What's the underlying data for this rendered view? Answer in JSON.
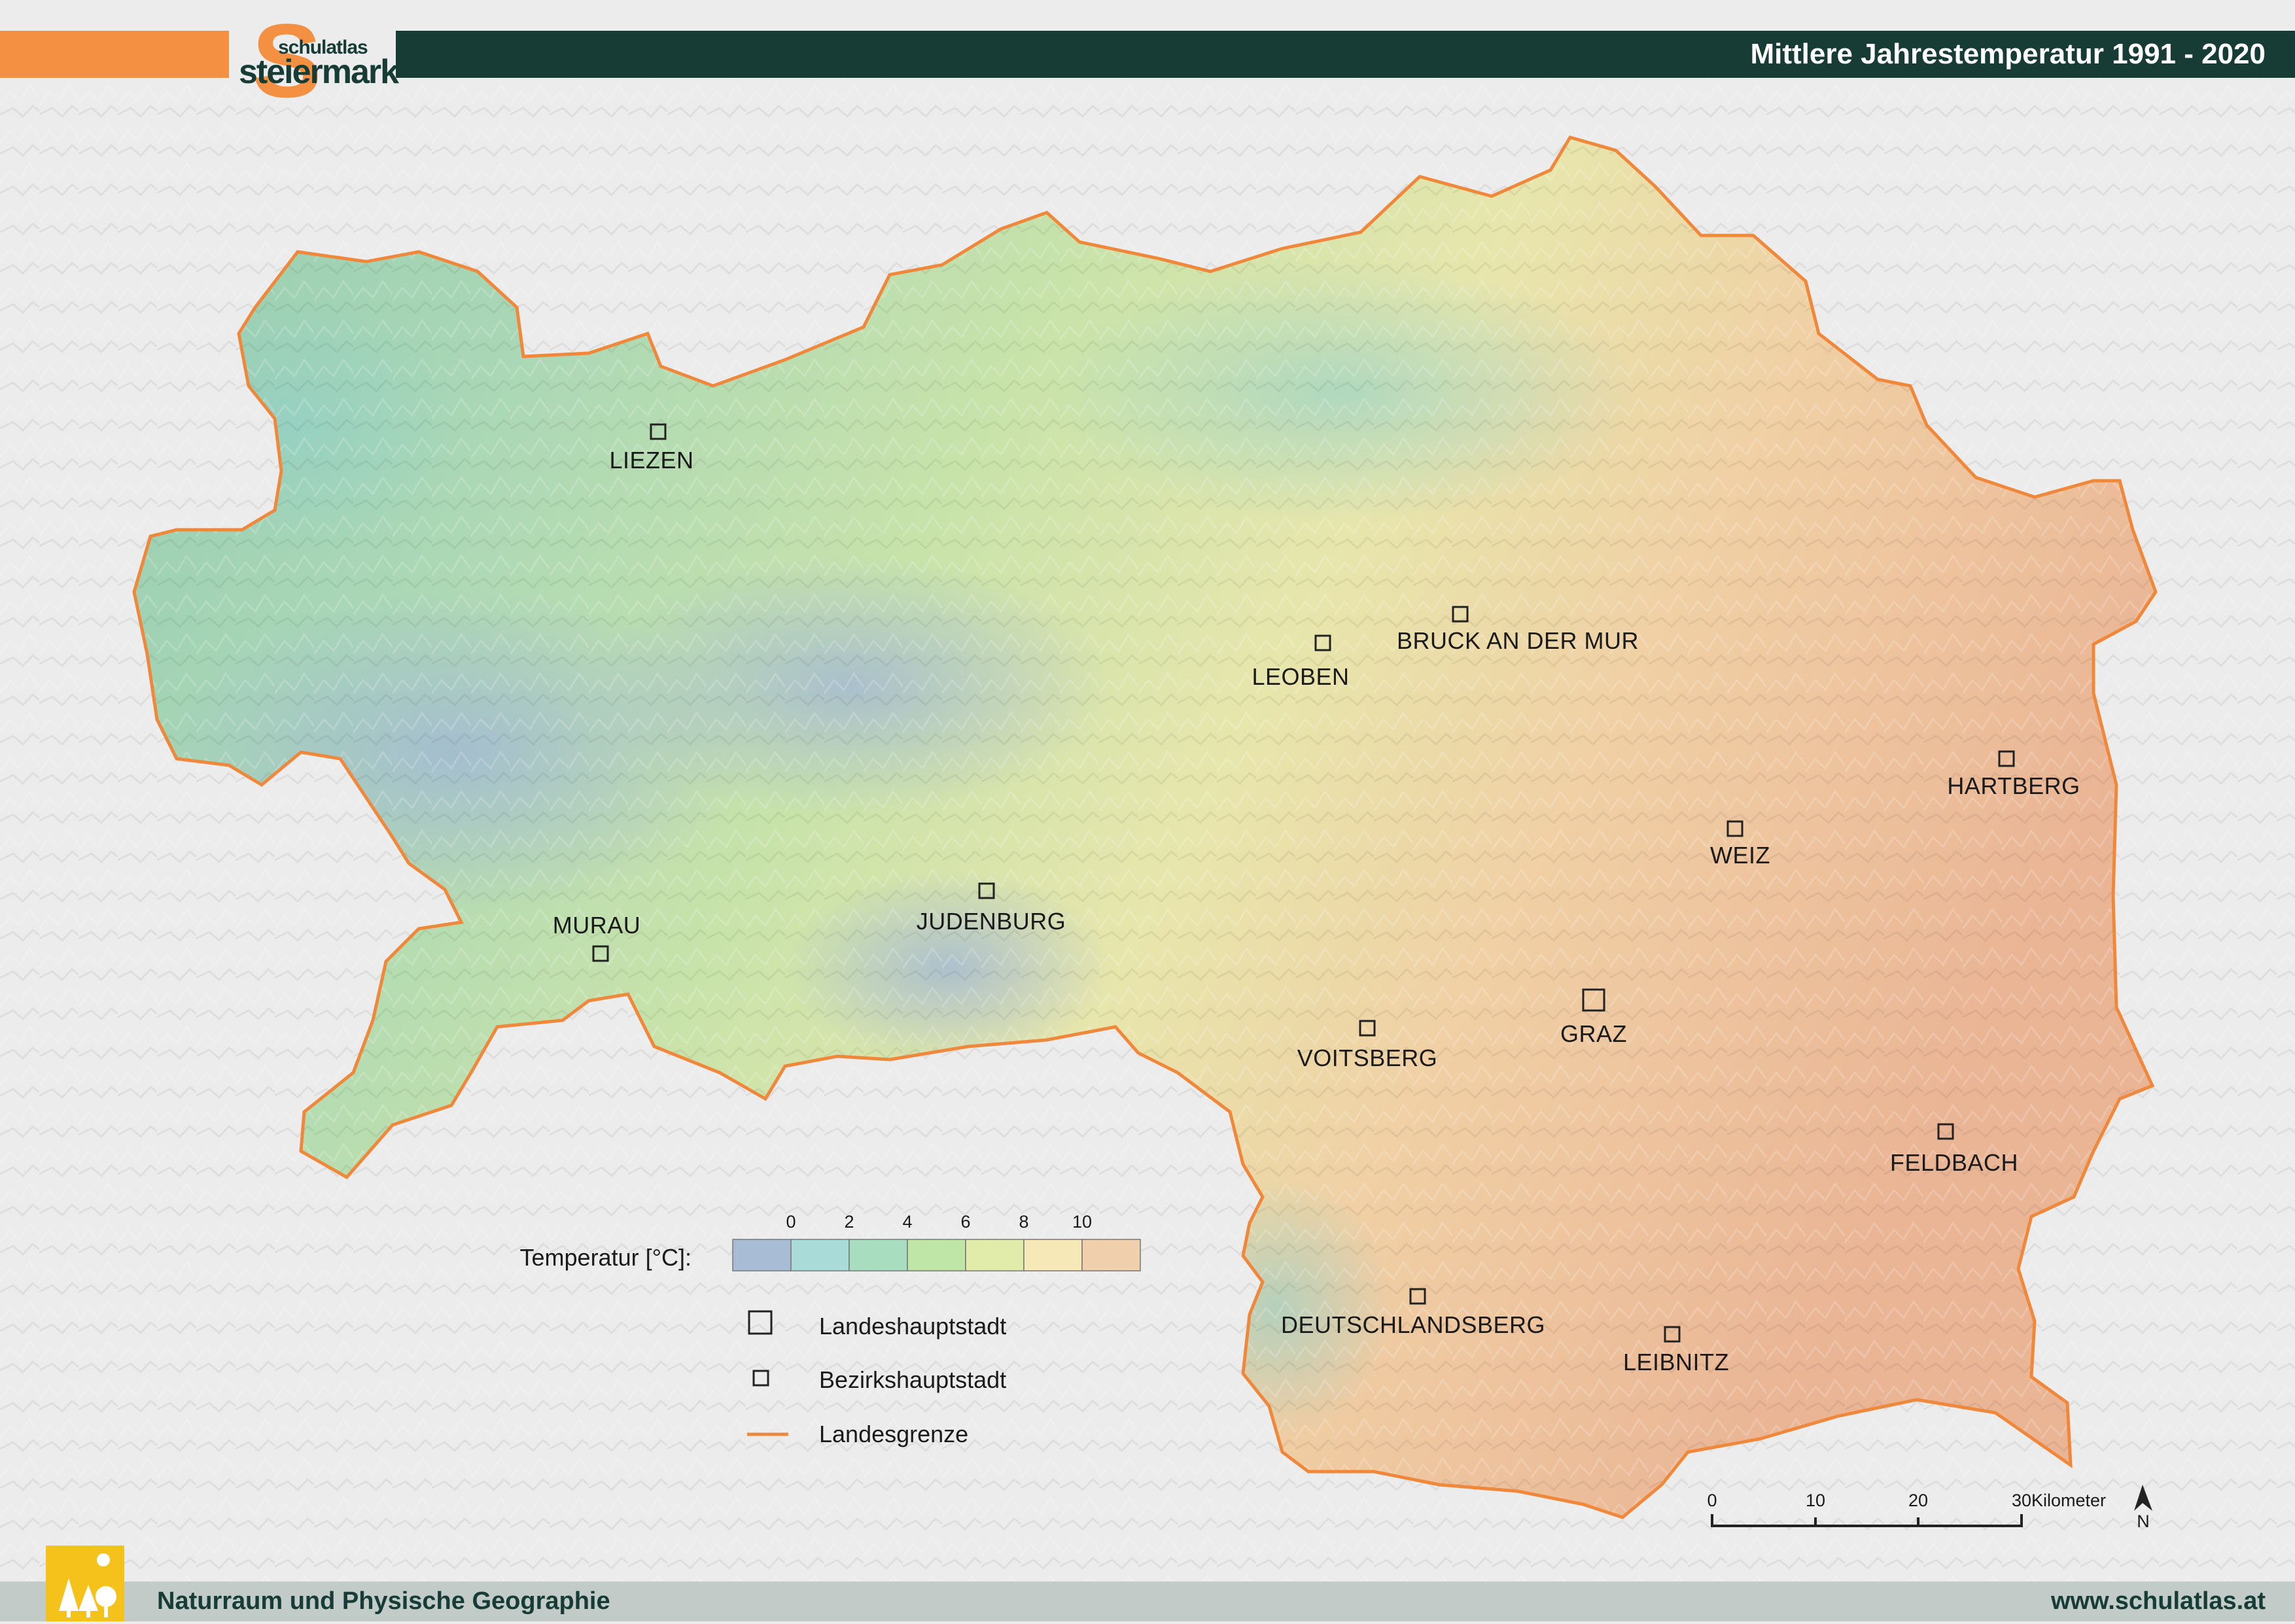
{
  "header": {
    "title": "Mittlere Jahrestemperatur 1991 - 2020",
    "logo_top": "schulatlas",
    "logo_bottom": "steiermark",
    "logo_letter": "S",
    "accent_color": "#f39042",
    "dark_color": "#163c35"
  },
  "cities": [
    {
      "name": "LIEZEN",
      "type": "bezirkshauptstadt"
    },
    {
      "name": "LEOBEN",
      "type": "bezirkshauptstadt"
    },
    {
      "name": "BRUCK AN DER MUR",
      "type": "bezirkshauptstadt"
    },
    {
      "name": "HARTBERG",
      "type": "bezirkshauptstadt"
    },
    {
      "name": "WEIZ",
      "type": "bezirkshauptstadt"
    },
    {
      "name": "MURAU",
      "type": "bezirkshauptstadt"
    },
    {
      "name": "JUDENBURG",
      "type": "bezirkshauptstadt"
    },
    {
      "name": "VOITSBERG",
      "type": "bezirkshauptstadt"
    },
    {
      "name": "GRAZ",
      "type": "landeshauptstadt"
    },
    {
      "name": "FELDBACH",
      "type": "bezirkshauptstadt"
    },
    {
      "name": "DEUTSCHLANDSBERG",
      "type": "bezirkshauptstadt"
    },
    {
      "name": "LEIBNITZ",
      "type": "bezirkshauptstadt"
    }
  ],
  "legend": {
    "temperature_label": "Temperatur [°C]:",
    "ticks": [
      "0",
      "2",
      "4",
      "6",
      "8",
      "10"
    ],
    "colors": [
      "#a9bcd5",
      "#a9dcd8",
      "#a9ddc0",
      "#bfe5a7",
      "#e1ecaa",
      "#f6e9b7",
      "#f0d0ac"
    ],
    "landeshauptstadt_label": "Landeshauptstadt",
    "bezirkshauptstadt_label": "Bezirkshauptstadt",
    "landesgrenze_label": "Landesgrenze",
    "border_color": "#f0883c"
  },
  "scale": {
    "ticks": [
      "0",
      "10",
      "20",
      "30"
    ],
    "unit": "Kilometer",
    "north": "N"
  },
  "footer": {
    "left": "Naturraum und Physische Geographie",
    "right": "www.schulatlas.at"
  }
}
